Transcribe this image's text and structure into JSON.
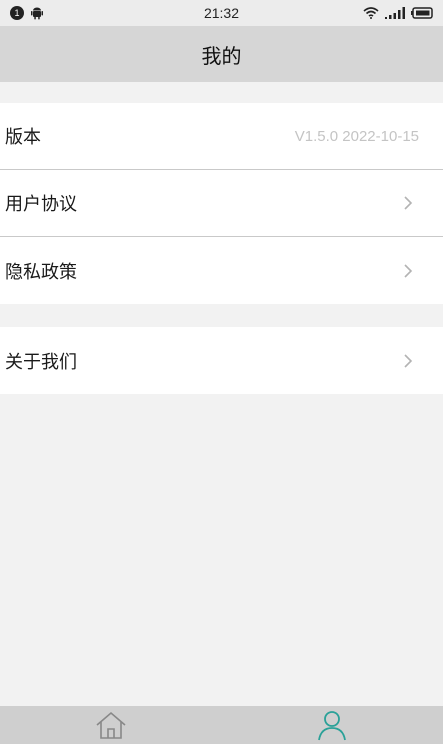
{
  "status_bar": {
    "notification_count": "1",
    "time": "21:32",
    "icons": [
      "notification-badge",
      "android-icon",
      "wifi-icon",
      "signal-icon",
      "battery-icon"
    ]
  },
  "header": {
    "title": "我的"
  },
  "groups": [
    {
      "items": [
        {
          "label": "版本",
          "value": "V1.5.0 2022-10-15"
        },
        {
          "label": "用户协议",
          "icon": "chevron-right-icon"
        },
        {
          "label": "隐私政策",
          "icon": "chevron-right-icon"
        }
      ]
    },
    {
      "items": [
        {
          "label": "关于我们",
          "icon": "chevron-right-icon"
        }
      ]
    }
  ],
  "tabbar": {
    "tabs": [
      {
        "icon": "home-icon",
        "active": false
      },
      {
        "icon": "person-icon",
        "active": true
      }
    ],
    "active_color": "#2aa198",
    "inactive_color": "#888888"
  }
}
